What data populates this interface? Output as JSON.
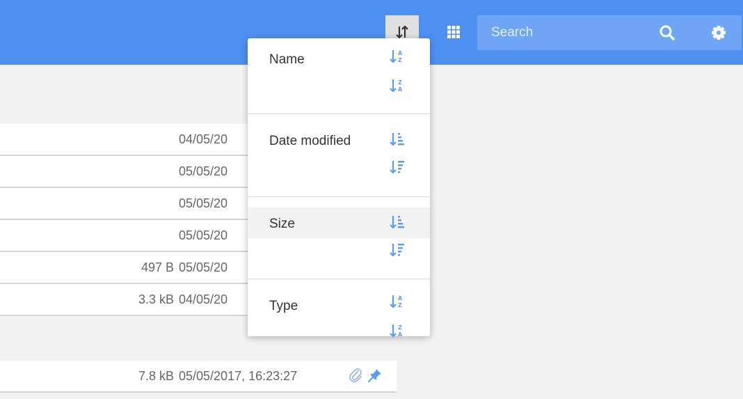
{
  "header": {
    "search": {
      "placeholder": "Search",
      "value": ""
    }
  },
  "icons": {
    "sort": "sort-arrows-icon",
    "grid": "grid-view-icon",
    "search": "search-icon",
    "settings": "gear-icon",
    "attachment": "paperclip-icon",
    "pin": "pin-icon"
  },
  "colors": {
    "topbar": "#4d90f0",
    "search_bg": "#6ea6f5",
    "accent_icon": "#5b9cf2"
  },
  "files": [
    {
      "size": "",
      "modified": "04/05/20"
    },
    {
      "size": "",
      "modified": "05/05/20"
    },
    {
      "size": "",
      "modified": "05/05/20"
    },
    {
      "size": "",
      "modified": "05/05/20"
    },
    {
      "size": "497 B",
      "modified": "05/05/20"
    },
    {
      "size": "3.3 kB",
      "modified": "04/05/20"
    },
    {
      "size": "7.8 kB",
      "modified": "05/05/2017, 16:23:27"
    }
  ],
  "sort_menu": {
    "options": [
      {
        "label": "Name",
        "asc_icon": "sort-alpha-asc-icon",
        "desc_icon": "sort-alpha-desc-icon"
      },
      {
        "label": "Date modified",
        "asc_icon": "sort-amount-asc-icon",
        "desc_icon": "sort-amount-desc-icon"
      },
      {
        "label": "Size",
        "asc_icon": "sort-amount-asc-icon",
        "desc_icon": "sort-amount-desc-icon",
        "highlighted": true
      },
      {
        "label": "Type",
        "asc_icon": "sort-alpha-asc-icon",
        "desc_icon": "sort-alpha-desc-icon"
      }
    ]
  }
}
